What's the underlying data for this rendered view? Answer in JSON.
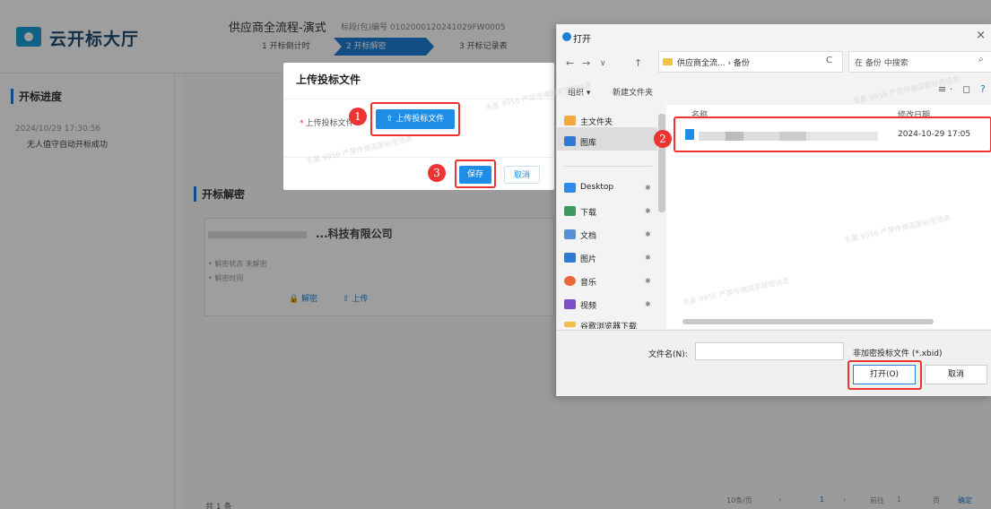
{
  "app": {
    "logo_text": "云开标大厅",
    "project_title": "供应商全流程-演式",
    "project_meta": "标段(包)编号 0102000120241029FW0005",
    "steps": [
      "1  开标倒计时",
      "2  开标解密",
      "3  开标记录表"
    ]
  },
  "left_panel": {
    "title": "开标进度",
    "time": "2024/10/29 17:30:56",
    "event": "无人值守自动开标成功"
  },
  "main": {
    "section_title": "开标解密",
    "company_suffix": "...科技有限公司",
    "status_line": "• 解密状态  未解密",
    "time_line": "• 解密时间",
    "decrypt_btn": "解密",
    "upload_btn": "上传",
    "total_text": "共 1 条",
    "page_size": "10条/页",
    "page_current": "1",
    "goto_label": "前往",
    "goto_value": "1",
    "goto_unit": "页",
    "confirm_btn": "确定"
  },
  "upload_modal": {
    "title": "上传投标文件",
    "field_label": "上传投标文件",
    "upload_btn": "上传投标文件",
    "save_btn": "保存",
    "cancel_btn": "取消"
  },
  "badges": [
    "1",
    "2",
    "3"
  ],
  "file_dialog": {
    "title": "打开",
    "close": "×",
    "path_text": "供应商全流... › 备份",
    "search_placeholder": "在 备份 中搜索",
    "organize": "组织 ▾",
    "new_folder": "新建文件夹",
    "col_name": "名称",
    "col_date": "修改日期",
    "file_date": "2024-10-29 17:05",
    "sidebar": [
      "主文件夹",
      "图库",
      "Desktop",
      "下载",
      "文档",
      "图片",
      "音乐",
      "视频",
      "谷歌浏览器下载"
    ],
    "filename_label": "文件名(N):",
    "filter_text": "非加密投标文件 (*.xbid)",
    "open_btn": "打开(O)",
    "cancel_btn": "取消"
  },
  "watermark": "毛星 9956 严禁传播国家秘密信息",
  "colors": {
    "accent": "#1e8de6",
    "highlight": "#e33333",
    "brand": "#1aa0d8"
  }
}
